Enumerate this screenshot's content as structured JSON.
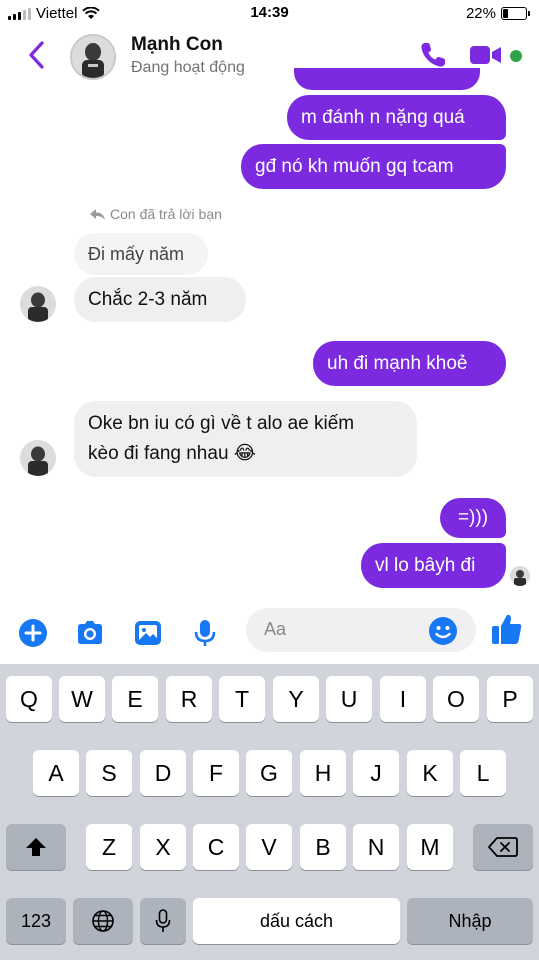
{
  "status_bar": {
    "carrier": "Viettel",
    "time": "14:39",
    "battery": "22%",
    "battery_level": 0.22
  },
  "header": {
    "contact_name": "Mạnh Con",
    "presence": "Đang hoạt động",
    "back_icon": "chevron-left-icon",
    "call_icon": "phone-icon",
    "video_icon": "video-camera-icon",
    "accent_color": "#7b2ae0",
    "online_color": "#31a24c"
  },
  "messages": [
    {
      "sender": "me",
      "text": "m đánh n nặng quá"
    },
    {
      "sender": "me",
      "text": "gđ nó kh muốn gq tcam"
    },
    {
      "sender": "contact",
      "reply_note": "Con đã trả lời bạn",
      "quoted": "Đi mấy năm",
      "text": "Chắc 2-3 năm"
    },
    {
      "sender": "me",
      "text": "uh đi mạnh khoẻ"
    },
    {
      "sender": "contact",
      "lines": [
        "Oke bn iu có gì về t alo ae kiếm",
        "kèo đi fang nhau 😂"
      ]
    },
    {
      "sender": "me",
      "text": "=)))"
    },
    {
      "sender": "me",
      "text": "vl lo bâyh đi"
    }
  ],
  "composer": {
    "placeholder": "Aa",
    "icons": [
      "plus-circle-icon",
      "camera-icon",
      "image-icon",
      "microphone-icon",
      "emoji-icon",
      "thumbs-up-icon"
    ]
  },
  "keyboard": {
    "row1": [
      "Q",
      "W",
      "E",
      "R",
      "T",
      "Y",
      "U",
      "I",
      "O",
      "P"
    ],
    "row2": [
      "A",
      "S",
      "D",
      "F",
      "G",
      "H",
      "J",
      "K",
      "L"
    ],
    "row3": [
      "Z",
      "X",
      "C",
      "V",
      "B",
      "N",
      "M"
    ],
    "numbers_key": "123",
    "space_key": "dấu cách",
    "return_key": "Nhập",
    "shift_icon": "shift-arrow-icon",
    "delete_icon": "backspace-icon",
    "globe_icon": "globe-icon",
    "dictation_icon": "microphone-icon"
  }
}
